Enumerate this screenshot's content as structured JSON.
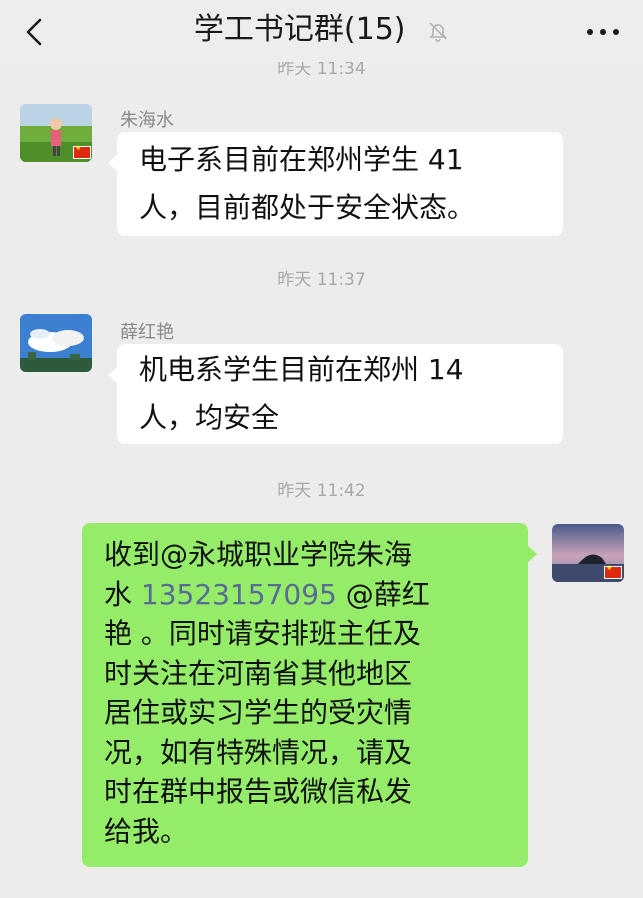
{
  "header": {
    "title": "学工书记群(15)"
  },
  "partial_timestamp": "昨天 11:34",
  "messages": [
    {
      "sender": "朱海水",
      "lines": [
        "电子系目前在郑州学生 41",
        "人，目前都处于安全状态。"
      ]
    },
    {
      "timestamp": "昨天 11:37",
      "sender": "薛红艳",
      "lines": [
        "机电系学生目前在郑州 14",
        "人，均安全"
      ]
    },
    {
      "timestamp": "昨天 11:42",
      "line1_prefix": "收到@永城职业学院朱海",
      "line2_prefix": "水 ",
      "phone": "13523157095",
      "line2_suffix": " @薛红",
      "lines_rest": [
        "艳 。同时请安排班主任及",
        "时关注在河南省其他地区",
        "居住或实习学生的受灾情",
        "况，如有特殊情况，请及",
        "时在群中报告或微信私发",
        "给我。"
      ]
    }
  ],
  "icons": {
    "back": "chevron-left-icon",
    "mute": "bell-off-icon",
    "more": "more-dots-icon"
  },
  "colors": {
    "background": "#ececec",
    "incoming_bubble": "#ffffff",
    "outgoing_bubble": "#95ec69",
    "link": "#576b95"
  }
}
